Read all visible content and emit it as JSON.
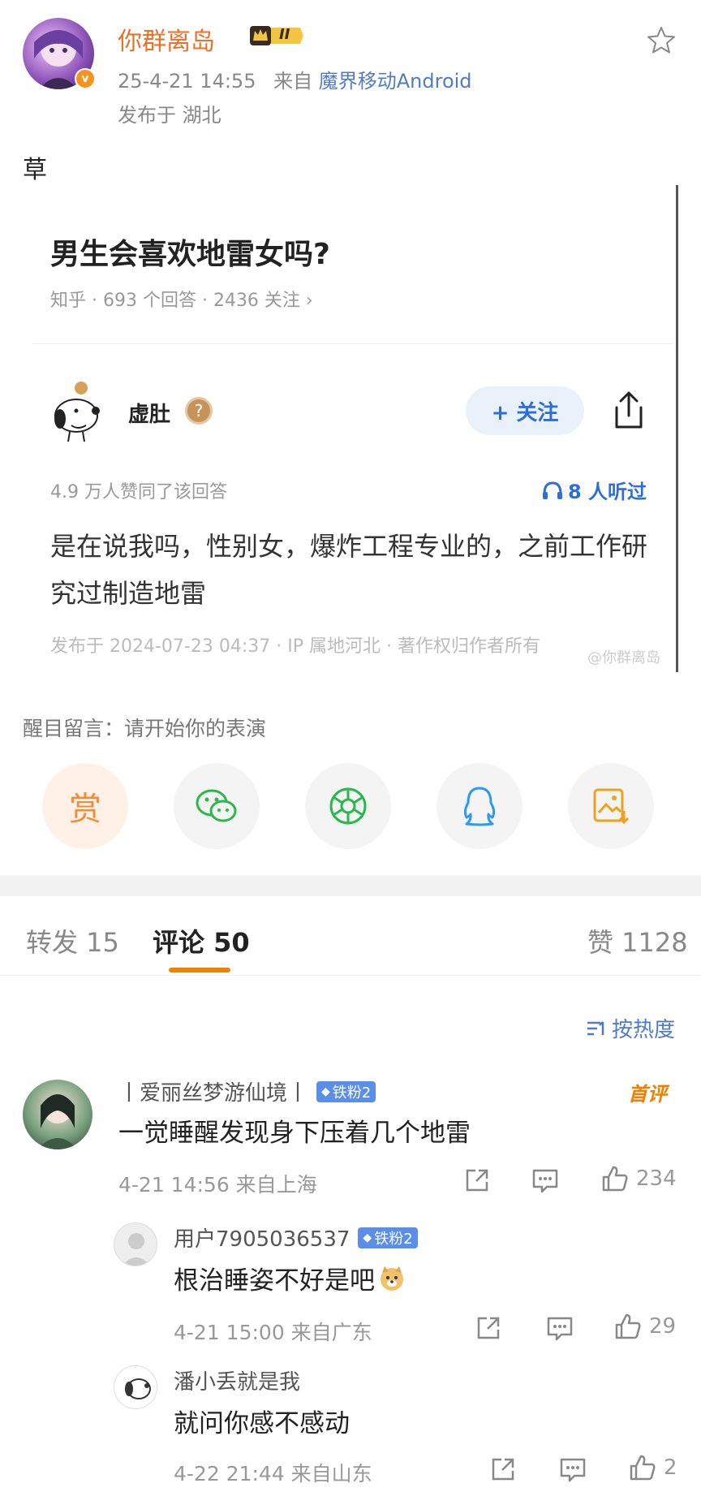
{
  "post": {
    "username": "你群离岛",
    "level_badge": "II",
    "time": "25-4-21 14:55",
    "from_label": "来自",
    "source": "魔界移动Android",
    "location": "发布于 湖北",
    "text": "草"
  },
  "embed": {
    "question_title": "男生会喜欢地雷女吗?",
    "question_meta": "知乎 · 693 个回答 · 2436 关注 ›",
    "answer_author": "虚肚",
    "follow_label": "+ 关注",
    "agree_text": "4.9 万人赞同了该回答",
    "listened_text": "8 人听过",
    "answer_text": "是在说我吗，性别女，爆炸工程专业的，之前工作研究过制造地雷",
    "footer": "发布于 2024-07-23 04:37 · IP 属地河北 · 著作权归作者所有",
    "watermark": "@你群离岛"
  },
  "eye_catching": "醒目留言：请开始你的表演",
  "action_buttons": [
    {
      "icon": "reward-icon",
      "label": "赏",
      "color": "#f08c3a"
    },
    {
      "icon": "wechat-icon",
      "color": "#2bb84a"
    },
    {
      "icon": "moments-icon",
      "color": "#2bb84a"
    },
    {
      "icon": "qq-icon",
      "color": "#2a9bf0"
    },
    {
      "icon": "save-image-icon",
      "color": "#f0a020"
    }
  ],
  "tabs": {
    "repost": "转发 15",
    "comments": "评论 50",
    "likes": "赞 1128"
  },
  "sort_label": "按热度",
  "comments": [
    {
      "name": "丨爱丽丝梦游仙境丨",
      "badge": "铁粉2",
      "first_tag": "首评",
      "text": "一觉睡醒发现身下压着几个地雷",
      "meta": "4-21 14:56  来自上海",
      "likes": "234"
    },
    {
      "name": "用户7905036537",
      "badge": "铁粉2",
      "text": "根治睡姿不好是吧",
      "meta": "4-21 15:00  来自广东",
      "likes": "29"
    },
    {
      "name": "潘小丢就是我",
      "text": "就问你感不感动",
      "meta": "4-22 21:44  来自山东",
      "likes": "2"
    }
  ]
}
